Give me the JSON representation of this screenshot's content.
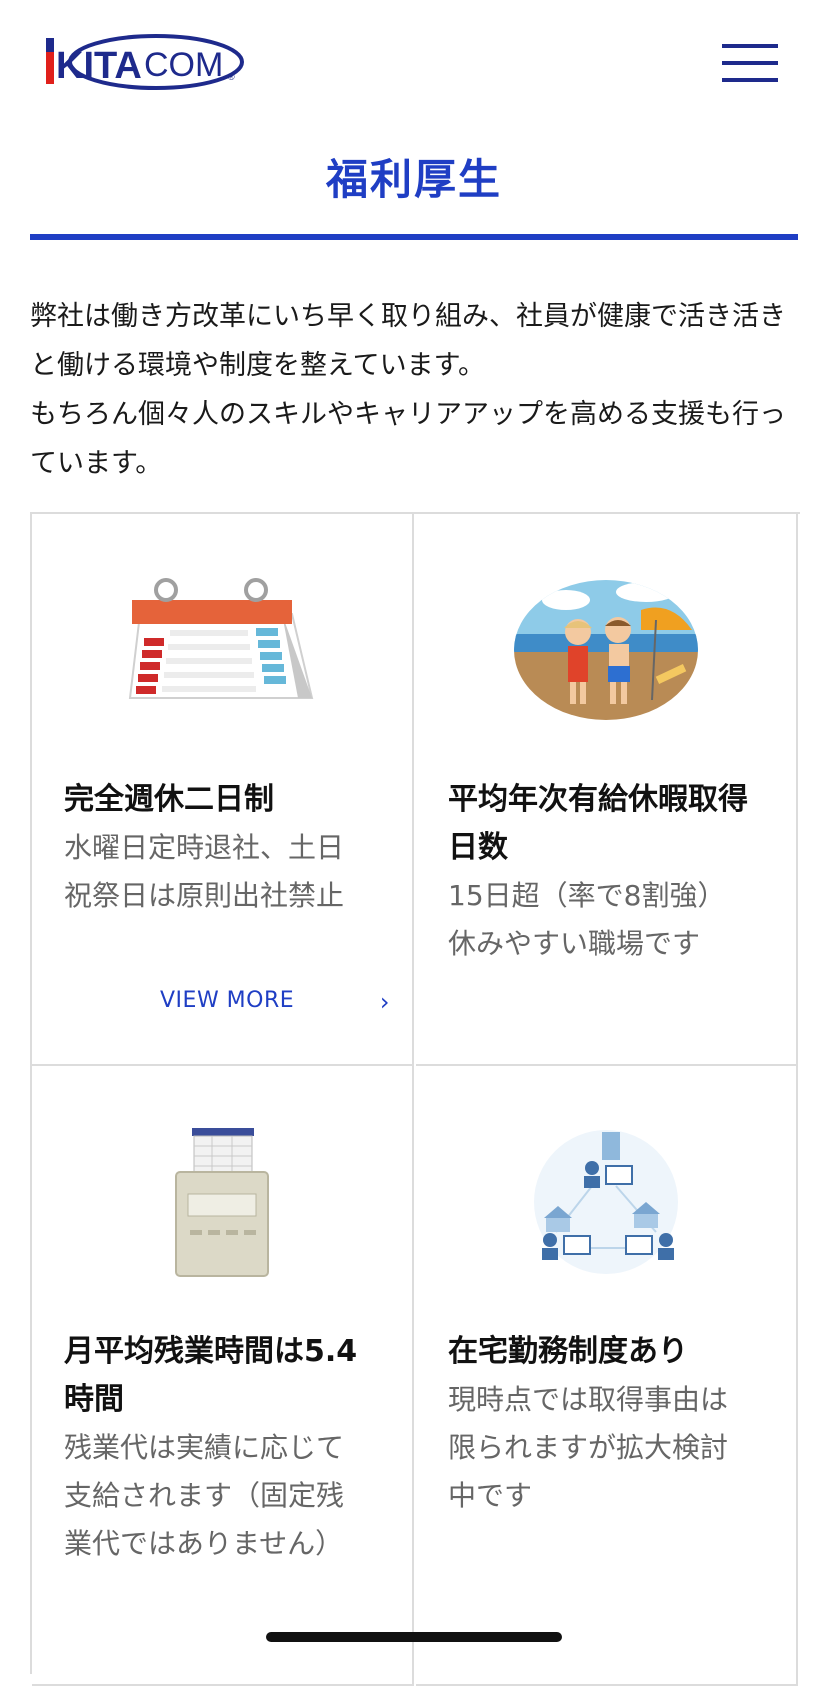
{
  "header": {
    "logo_text_bold": "KITA",
    "logo_text_light": "COM",
    "logo_mark": "®",
    "menu_icon": "hamburger-menu-icon"
  },
  "page": {
    "title": "福利厚生",
    "intro": [
      "弊社は働き方改革にいち早く取り組み、社員が健康で活き活きと働ける環境や制度を整えています。",
      "もちろん個々人のスキルやキャリアアップを高める支援も行っています。"
    ]
  },
  "cards": [
    {
      "icon": "calendar-icon",
      "title": "完全週休二日制",
      "desc": "水曜日定時退社、土日祝祭日は原則出社禁止",
      "link": "VIEW MORE"
    },
    {
      "icon": "beach-vacation-icon",
      "title": "平均年次有給休暇取得日数",
      "desc": "15日超（率で8割強）休みやすい職場です"
    },
    {
      "icon": "time-clock-icon",
      "title": "月平均残業時間は5.4時間",
      "desc": "残業代は実績に応じて支給されます（固定残業代ではありません）"
    },
    {
      "icon": "remote-work-icon",
      "title": "在宅勤務制度あり",
      "desc": "現時点では取得事由は限られますが拡大検討中です"
    }
  ],
  "colors": {
    "accent": "#1f3ec4",
    "logo_red": "#e0201b",
    "logo_navy": "#1e2a8c",
    "border": "#dcdcdc"
  }
}
